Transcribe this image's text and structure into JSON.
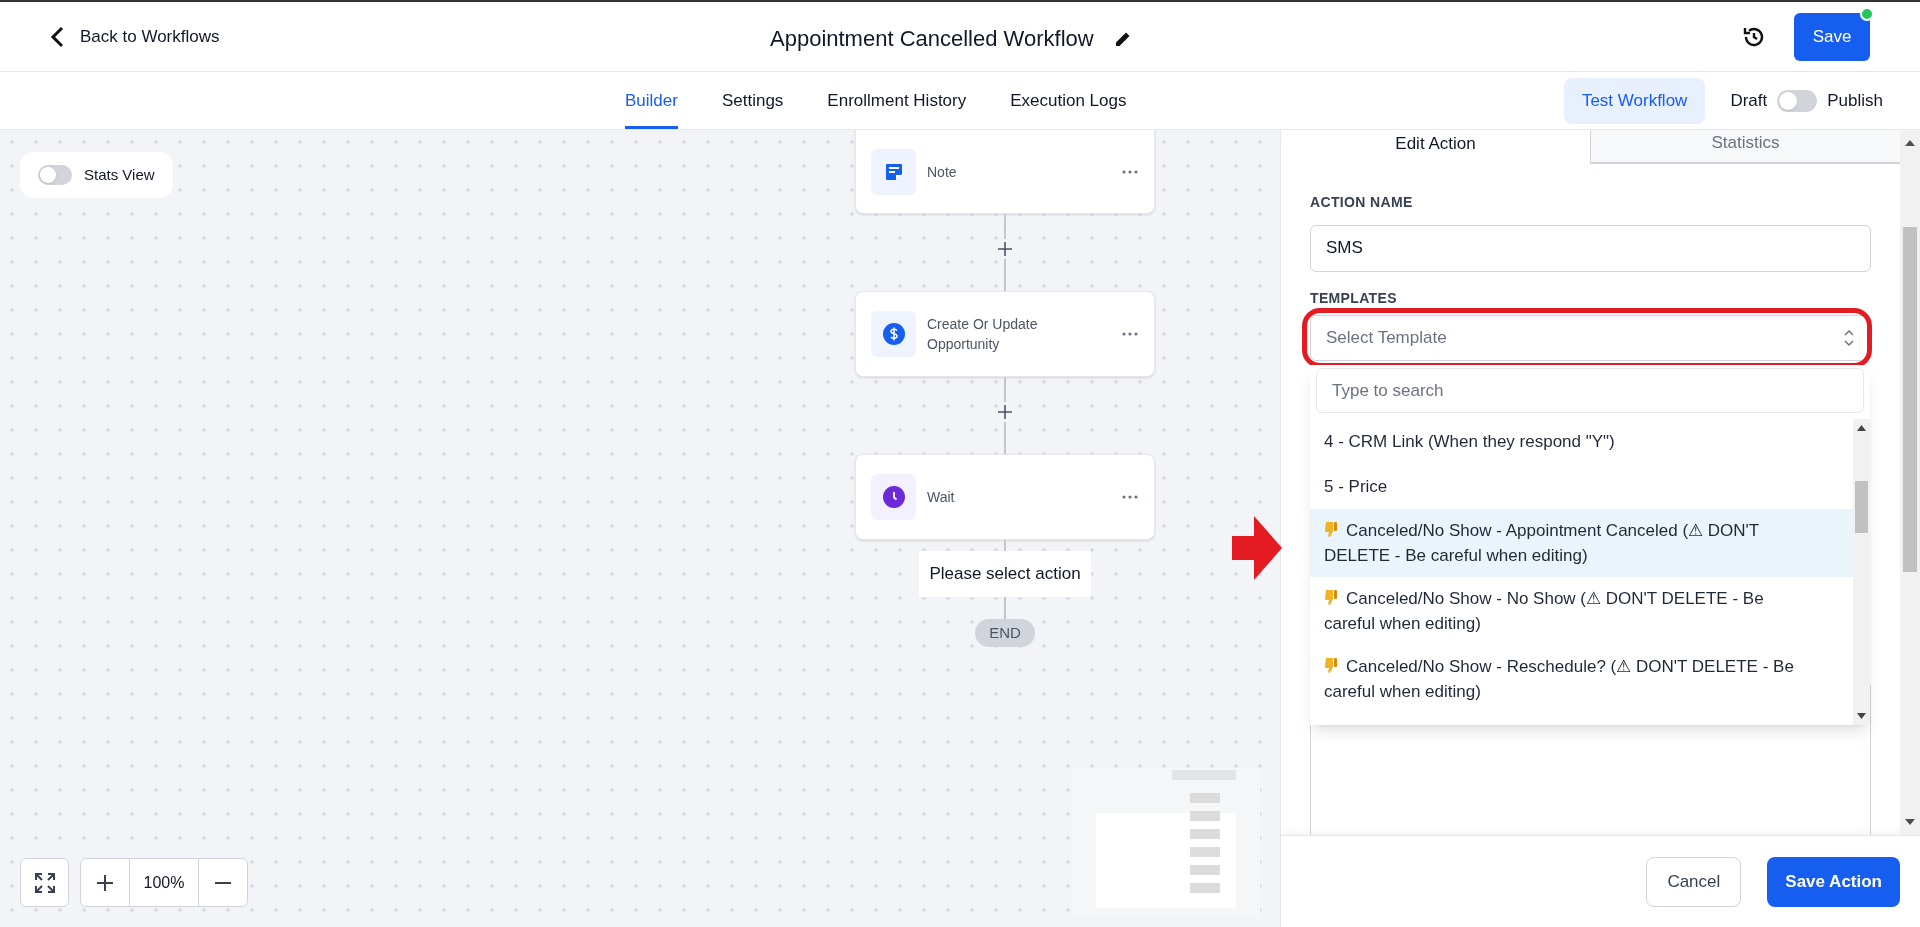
{
  "header": {
    "back_link": "Back to Workflows",
    "title": "Appointment Cancelled Workflow",
    "save_button": "Save"
  },
  "nav_tabs": [
    {
      "label": "Builder",
      "selected": true
    },
    {
      "label": "Settings",
      "selected": false
    },
    {
      "label": "Enrollment History",
      "selected": false
    },
    {
      "label": "Execution Logs",
      "selected": false
    }
  ],
  "test_button": "Test Workflow",
  "publish_toggle": {
    "off_label": "Draft",
    "on_label": "Publish",
    "on": false
  },
  "canvas": {
    "stats_toggle": {
      "label": "Stats View",
      "on": false
    },
    "nodes": [
      {
        "kind": "note",
        "label": "Note"
      },
      {
        "kind": "opportunity",
        "label": "Create Or Update Opportunity"
      },
      {
        "kind": "wait",
        "label": "Wait"
      }
    ],
    "placeholder": "Please select action",
    "end_label": "END",
    "zoom": "100%"
  },
  "panel": {
    "tabs": [
      {
        "label": "Edit Action",
        "selected": true
      },
      {
        "label": "Statistics",
        "selected": false
      }
    ],
    "action_name_label": "ACTION NAME",
    "action_name": "SMS",
    "templates_label": "TEMPLATES",
    "template_placeholder": "Select Template",
    "search_placeholder": "Type to search",
    "options": [
      {
        "kind": "plain",
        "label": "4 - CRM Link (When they respond \"Y\")",
        "selected": false
      },
      {
        "kind": "plain",
        "label": "5 - Price",
        "selected": false
      },
      {
        "kind": "flagged",
        "label": "Canceled/No Show - Appointment Canceled (⚠ DON'T DELETE - Be careful when editing)",
        "selected": true
      },
      {
        "kind": "flagged",
        "label": "Canceled/No Show - No Show (⚠ DON'T DELETE - Be careful when editing)",
        "selected": false
      },
      {
        "kind": "flagged",
        "label": "Canceled/No Show - Reschedule? (⚠ DON'T DELETE - Be careful when editing)",
        "selected": false
      }
    ],
    "cancel": "Cancel",
    "save_action": "Save Action"
  }
}
